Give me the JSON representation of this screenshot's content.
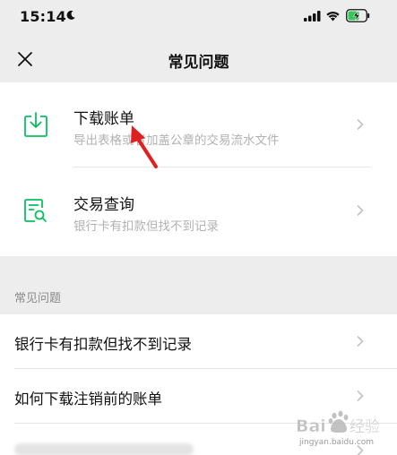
{
  "status_bar": {
    "time": "15:14",
    "icons": [
      "moon-icon",
      "signal-icon",
      "wifi-icon",
      "battery-charging-icon"
    ]
  },
  "nav": {
    "close_icon": "close-icon",
    "title": "常见问题"
  },
  "tools": [
    {
      "title": "下载账单",
      "subtitle": "导出表格或者加盖公章的交易流水文件",
      "icon": "download-bill-icon"
    },
    {
      "title": "交易查询",
      "subtitle": "银行卡有扣款但找不到记录",
      "icon": "transaction-search-icon"
    }
  ],
  "faq": {
    "header": "常见问题",
    "items": [
      {
        "label": "银行卡有扣款但找不到记录"
      },
      {
        "label": "如何下载注销前的账单"
      }
    ]
  },
  "watermark": {
    "brand": "Baidu 经验",
    "url": "jingyan.baidu.com"
  },
  "colors": {
    "accent_green": "#07c160",
    "annotation_red": "#e02020",
    "background": "#ededed"
  }
}
